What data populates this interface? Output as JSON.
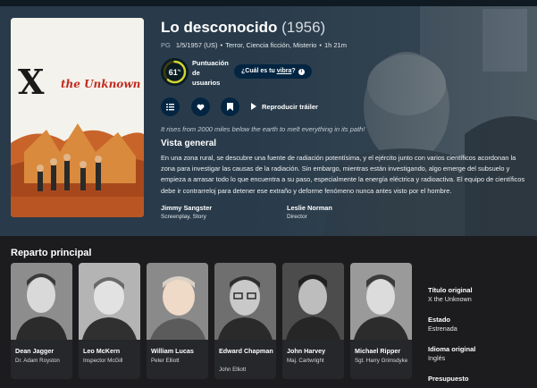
{
  "movie": {
    "title": "Lo desconocido",
    "year": "(1956)",
    "certification": "PG",
    "release": "1/5/1957 (US)",
    "genres": "Terror, Ciencia ficción, Misterio",
    "runtime": "1h 21m",
    "poster": {
      "title_x": "X",
      "title_rest": "the Unknown"
    }
  },
  "score": {
    "value": "61",
    "percent_sign": "%",
    "fraction": 0.61,
    "label": "Puntuación de usuarios",
    "ring_color": "#d2d531"
  },
  "vibe": {
    "prefix": "¿Cuál es tu ",
    "word": "vibra",
    "suffix": "?",
    "info_icon": "i"
  },
  "actions": {
    "list_icon": "list-icon",
    "favorite_icon": "heart-icon",
    "watchlist_icon": "bookmark-icon",
    "trailer_label": "Reproducir tráiler"
  },
  "tagline": "It rises from 2000 miles below the earth to melt everything in its path!",
  "overview_heading": "Vista general",
  "overview": "En una zona rural, se descubre una fuente de radiación potentísima, y el ejército junto con varios científicos acordonan la zona para investigar las causas de la radiación. Sin embargo, mientras están investigando, algo emerge del subsuelo y empieza a arrasar todo lo que encuentra a su paso, especialmente la energía eléctrica y radioactiva. El equipo de científicos debe ir contrarreloj para detener ese extraño y deforme fenómeno nunca antes visto por el hombre.",
  "crew": [
    {
      "name": "Jimmy Sangster",
      "job": "Screenplay, Story"
    },
    {
      "name": "Leslie Norman",
      "job": "Director"
    }
  ],
  "cast_heading": "Reparto principal",
  "cast": [
    {
      "name": "Dean Jagger",
      "role": "Dr. Adam Royston"
    },
    {
      "name": "Leo McKern",
      "role": "Inspector McGill"
    },
    {
      "name": "William Lucas",
      "role": "Peter Elliott"
    },
    {
      "name": "Edward Chapman",
      "role": "John Elliott"
    },
    {
      "name": "John Harvey",
      "role": "Maj. Cartwright"
    },
    {
      "name": "Michael Ripper",
      "role": "Sgt. Harry Grimsdyke"
    }
  ],
  "side_facts": [
    {
      "label": "Título original",
      "value": "X the Unknown"
    },
    {
      "label": "Estado",
      "value": "Estrenada"
    },
    {
      "label": "Idioma original",
      "value": "Inglés"
    },
    {
      "label": "Presupuesto",
      "value": ""
    }
  ],
  "colors": {
    "hero_tint": "#283a4a",
    "button_bg": "#032541",
    "page_bg": "#1c1c1f"
  }
}
